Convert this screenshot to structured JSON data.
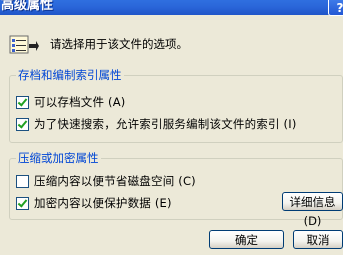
{
  "window": {
    "title": "高级属性",
    "help_button": "?"
  },
  "intro": {
    "text": "请选择用于该文件的选项。",
    "icon": "properties-icon"
  },
  "archive_index_group": {
    "legend": "存档和编制索引属性",
    "items": [
      {
        "label": "可以存档文件 (A)",
        "checked": true
      },
      {
        "label": "为了快速搜索，允许索引服务编制该文件的索引 (I)",
        "checked": true
      }
    ]
  },
  "compress_encrypt_group": {
    "legend": "压缩或加密属性",
    "items": [
      {
        "label": "压缩内容以便节省磁盘空间 (C)",
        "checked": false
      },
      {
        "label": "加密内容以便保护数据 (E)",
        "checked": true
      }
    ],
    "details_button": "详细信息 (D)"
  },
  "buttons": {
    "ok": "确定",
    "cancel": "取消"
  }
}
